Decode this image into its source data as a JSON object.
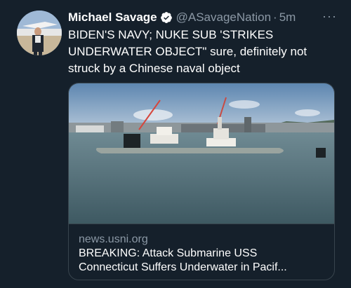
{
  "tweet": {
    "author_name": "Michael Savage",
    "handle": "@ASavageNation",
    "separator": "·",
    "time": "5m",
    "more_label": "···",
    "text": "BIDEN'S NAVY; NUKE SUB 'STRIKES UNDERWATER OBJECT\" sure, definitely not struck by a Chinese naval object"
  },
  "card": {
    "domain": "news.usni.org",
    "title_line1": "BREAKING: Attack Submarine USS",
    "title_line2": "Connecticut Suffers Underwater in Pacif..."
  },
  "colors": {
    "background": "#15202b",
    "text_primary": "#ffffff",
    "text_secondary": "#8b98a5",
    "verified_badge": "#1d9bf0",
    "card_border": "#38444d"
  },
  "icons": {
    "verified": "verified-badge-icon",
    "more": "more-options-icon"
  }
}
